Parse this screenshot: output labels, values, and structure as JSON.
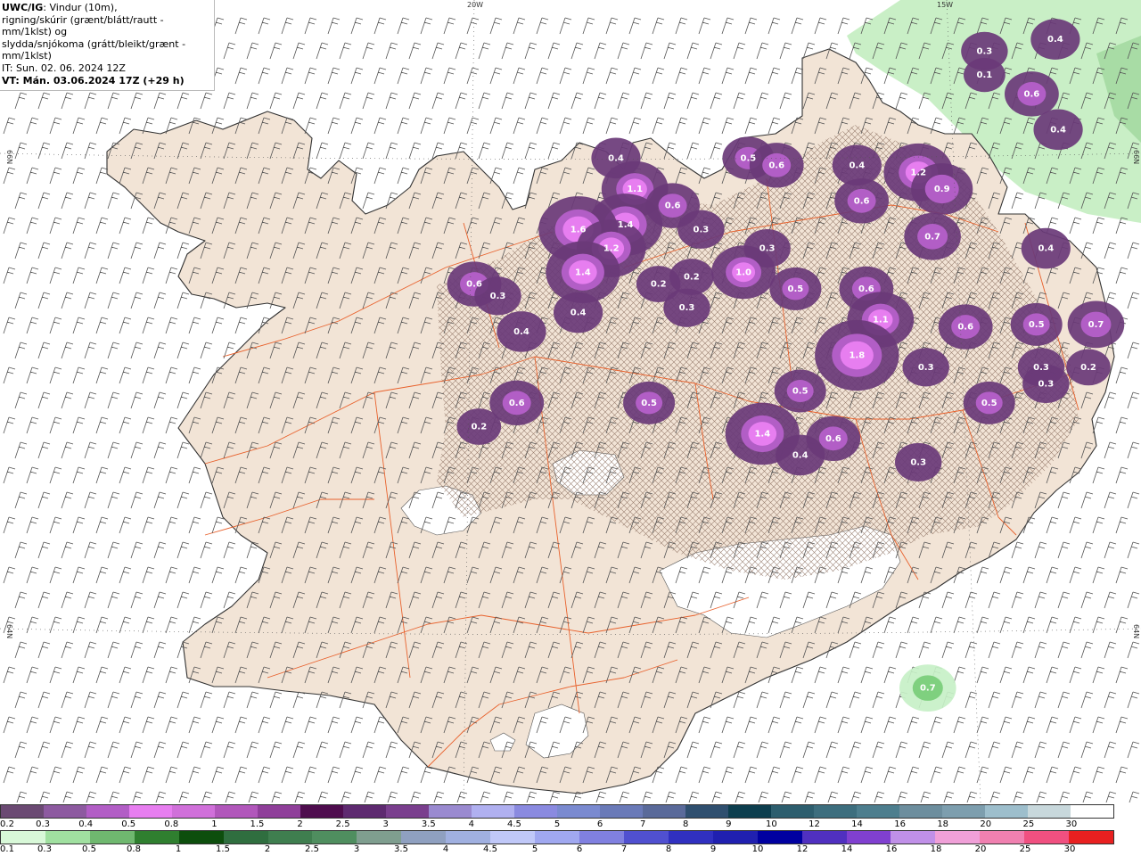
{
  "header": {
    "product": "UWC/IG",
    "line1_rest": ": Vindur (10m),",
    "line2": "rigning/skúrir (grænt/blátt/rautt - mm/1klst) og",
    "line3": "slydda/snjókoma (grátt/bleikt/grænt - mm/1klst)",
    "line4": "IT: Sun. 02. 06. 2024 12Z",
    "line5": "VT: Mán. 03.06.2024 17Z (+29 h)"
  },
  "coords": {
    "top_20w": "20W",
    "top_15w": "15W",
    "left_66n": "66N",
    "right_66n": "66N",
    "left_64n": "64N",
    "right_64n": "64N"
  },
  "colors": {
    "sea": "#ffffff",
    "land": "#f2e4d6",
    "roads": "#e8612c",
    "coast": "#333333",
    "barbs": "#555555",
    "rain_light": "#c7f0c7",
    "rain_mid": "#7fd07f",
    "snow_dark": "#6a3a78",
    "snow_mid": "#b25ec6",
    "snow_bright": "#e77ef0"
  },
  "precip_labels": [
    {
      "text": "0.3",
      "lon": -14.6,
      "lat": 66.43
    },
    {
      "text": "0.1",
      "lon": -14.6,
      "lat": 66.33
    },
    {
      "text": "0.4",
      "lon": -13.85,
      "lat": 66.48
    },
    {
      "text": "0.6",
      "lon": -14.1,
      "lat": 66.25
    },
    {
      "text": "0.4",
      "lon": -13.82,
      "lat": 66.1
    },
    {
      "text": "1.2",
      "lon": -15.3,
      "lat": 65.92
    },
    {
      "text": "0.9",
      "lon": -15.05,
      "lat": 65.85
    },
    {
      "text": "0.7",
      "lon": -15.15,
      "lat": 65.65
    },
    {
      "text": "0.4",
      "lon": -13.95,
      "lat": 65.6
    },
    {
      "text": "0.4",
      "lon": -18.5,
      "lat": 65.98
    },
    {
      "text": "1.1",
      "lon": -18.3,
      "lat": 65.85
    },
    {
      "text": "0.6",
      "lon": -17.9,
      "lat": 65.78
    },
    {
      "text": "1.4",
      "lon": -18.4,
      "lat": 65.7
    },
    {
      "text": "1.6",
      "lon": -18.9,
      "lat": 65.68
    },
    {
      "text": "1.2",
      "lon": -18.55,
      "lat": 65.6
    },
    {
      "text": "1.4",
      "lon": -18.85,
      "lat": 65.5
    },
    {
      "text": "0.5",
      "lon": -17.1,
      "lat": 65.98
    },
    {
      "text": "0.6",
      "lon": -16.8,
      "lat": 65.95
    },
    {
      "text": "0.4",
      "lon": -15.95,
      "lat": 65.95
    },
    {
      "text": "0.6",
      "lon": -15.9,
      "lat": 65.8
    },
    {
      "text": "0.3",
      "lon": -17.6,
      "lat": 65.68
    },
    {
      "text": "0.3",
      "lon": -16.9,
      "lat": 65.6
    },
    {
      "text": "1.0",
      "lon": -17.15,
      "lat": 65.5
    },
    {
      "text": "0.5",
      "lon": -16.6,
      "lat": 65.43
    },
    {
      "text": "0.2",
      "lon": -18.05,
      "lat": 65.45
    },
    {
      "text": "0.2",
      "lon": -17.7,
      "lat": 65.48
    },
    {
      "text": "0.3",
      "lon": -17.75,
      "lat": 65.35
    },
    {
      "text": "0.4",
      "lon": -18.9,
      "lat": 65.33
    },
    {
      "text": "0.4",
      "lon": -19.5,
      "lat": 65.25
    },
    {
      "text": "0.6",
      "lon": -20.0,
      "lat": 65.45
    },
    {
      "text": "0.3",
      "lon": -19.75,
      "lat": 65.4
    },
    {
      "text": "0.6",
      "lon": -15.85,
      "lat": 65.43
    },
    {
      "text": "1.1",
      "lon": -15.7,
      "lat": 65.3
    },
    {
      "text": "1.8",
      "lon": -15.95,
      "lat": 65.15
    },
    {
      "text": "0.6",
      "lon": -14.8,
      "lat": 65.27
    },
    {
      "text": "0.5",
      "lon": -14.05,
      "lat": 65.28
    },
    {
      "text": "0.7",
      "lon": -13.42,
      "lat": 65.28
    },
    {
      "text": "0.3",
      "lon": -15.22,
      "lat": 65.1
    },
    {
      "text": "0.3",
      "lon": -14.0,
      "lat": 65.1
    },
    {
      "text": "0.3",
      "lon": -13.95,
      "lat": 65.03
    },
    {
      "text": "0.2",
      "lon": -13.5,
      "lat": 65.1
    },
    {
      "text": "0.5",
      "lon": -16.55,
      "lat": 65.0
    },
    {
      "text": "0.5",
      "lon": -14.55,
      "lat": 64.95
    },
    {
      "text": "0.6",
      "lon": -19.55,
      "lat": 64.95
    },
    {
      "text": "0.5",
      "lon": -18.15,
      "lat": 64.95
    },
    {
      "text": "0.2",
      "lon": -19.95,
      "lat": 64.85
    },
    {
      "text": "1.4",
      "lon": -16.95,
      "lat": 64.82
    },
    {
      "text": "0.6",
      "lon": -16.2,
      "lat": 64.8
    },
    {
      "text": "0.4",
      "lon": -16.55,
      "lat": 64.73
    },
    {
      "text": "0.3",
      "lon": -15.3,
      "lat": 64.7
    },
    {
      "text": "0.7",
      "lon": -15.2,
      "lat": 63.75
    }
  ],
  "legend_snow": {
    "labels": [
      "0.2",
      "0.3",
      "0.4",
      "0.5",
      "0.8",
      "1",
      "1.5",
      "2",
      "2.5",
      "3",
      "3.5",
      "4",
      "4.5",
      "5",
      "6",
      "7",
      "8",
      "9",
      "10",
      "12",
      "14",
      "16",
      "18",
      "20",
      "25",
      "30"
    ],
    "colors": [
      "#6b4a73",
      "#8d5aa0",
      "#b25ec6",
      "#e77ef0",
      "#d070da",
      "#b157bb",
      "#8f3f9a",
      "#4e0d4e",
      "#5e2a70",
      "#7a3f8e",
      "#9a8ad0",
      "#b0b0f0",
      "#8a8ae0",
      "#7a8ad0",
      "#6a7ab8",
      "#5a6a9a",
      "#2f4f6f",
      "#0d3e4e",
      "#2d5e6e",
      "#3d6e7e",
      "#4d7e8e",
      "#6d8e9e",
      "#7d9eae",
      "#9dbecc",
      "#c8d8dc",
      "#ffffff"
    ]
  },
  "legend_rain": {
    "labels": [
      "0.1",
      "0.3",
      "0.5",
      "0.8",
      "1",
      "1.5",
      "2",
      "2.5",
      "3",
      "3.5",
      "4",
      "4.5",
      "5",
      "6",
      "7",
      "8",
      "9",
      "10",
      "12",
      "14",
      "16",
      "18",
      "20",
      "25",
      "30"
    ],
    "colors": [
      "#d8f8d8",
      "#a0e0a0",
      "#6fb86f",
      "#2f7f2f",
      "#0d4e0d",
      "#2f6e3f",
      "#3f7e4f",
      "#4f8e5f",
      "#7f9e8f",
      "#8fa0c0",
      "#a0b0e0",
      "#c0c8f8",
      "#a0a8f0",
      "#8080e0",
      "#5050d0",
      "#3030c0",
      "#2020b0",
      "#0000a0",
      "#5030c0",
      "#8040d0",
      "#c090e8",
      "#f0a0d8",
      "#f080b0",
      "#f05080",
      "#e82020"
    ]
  }
}
